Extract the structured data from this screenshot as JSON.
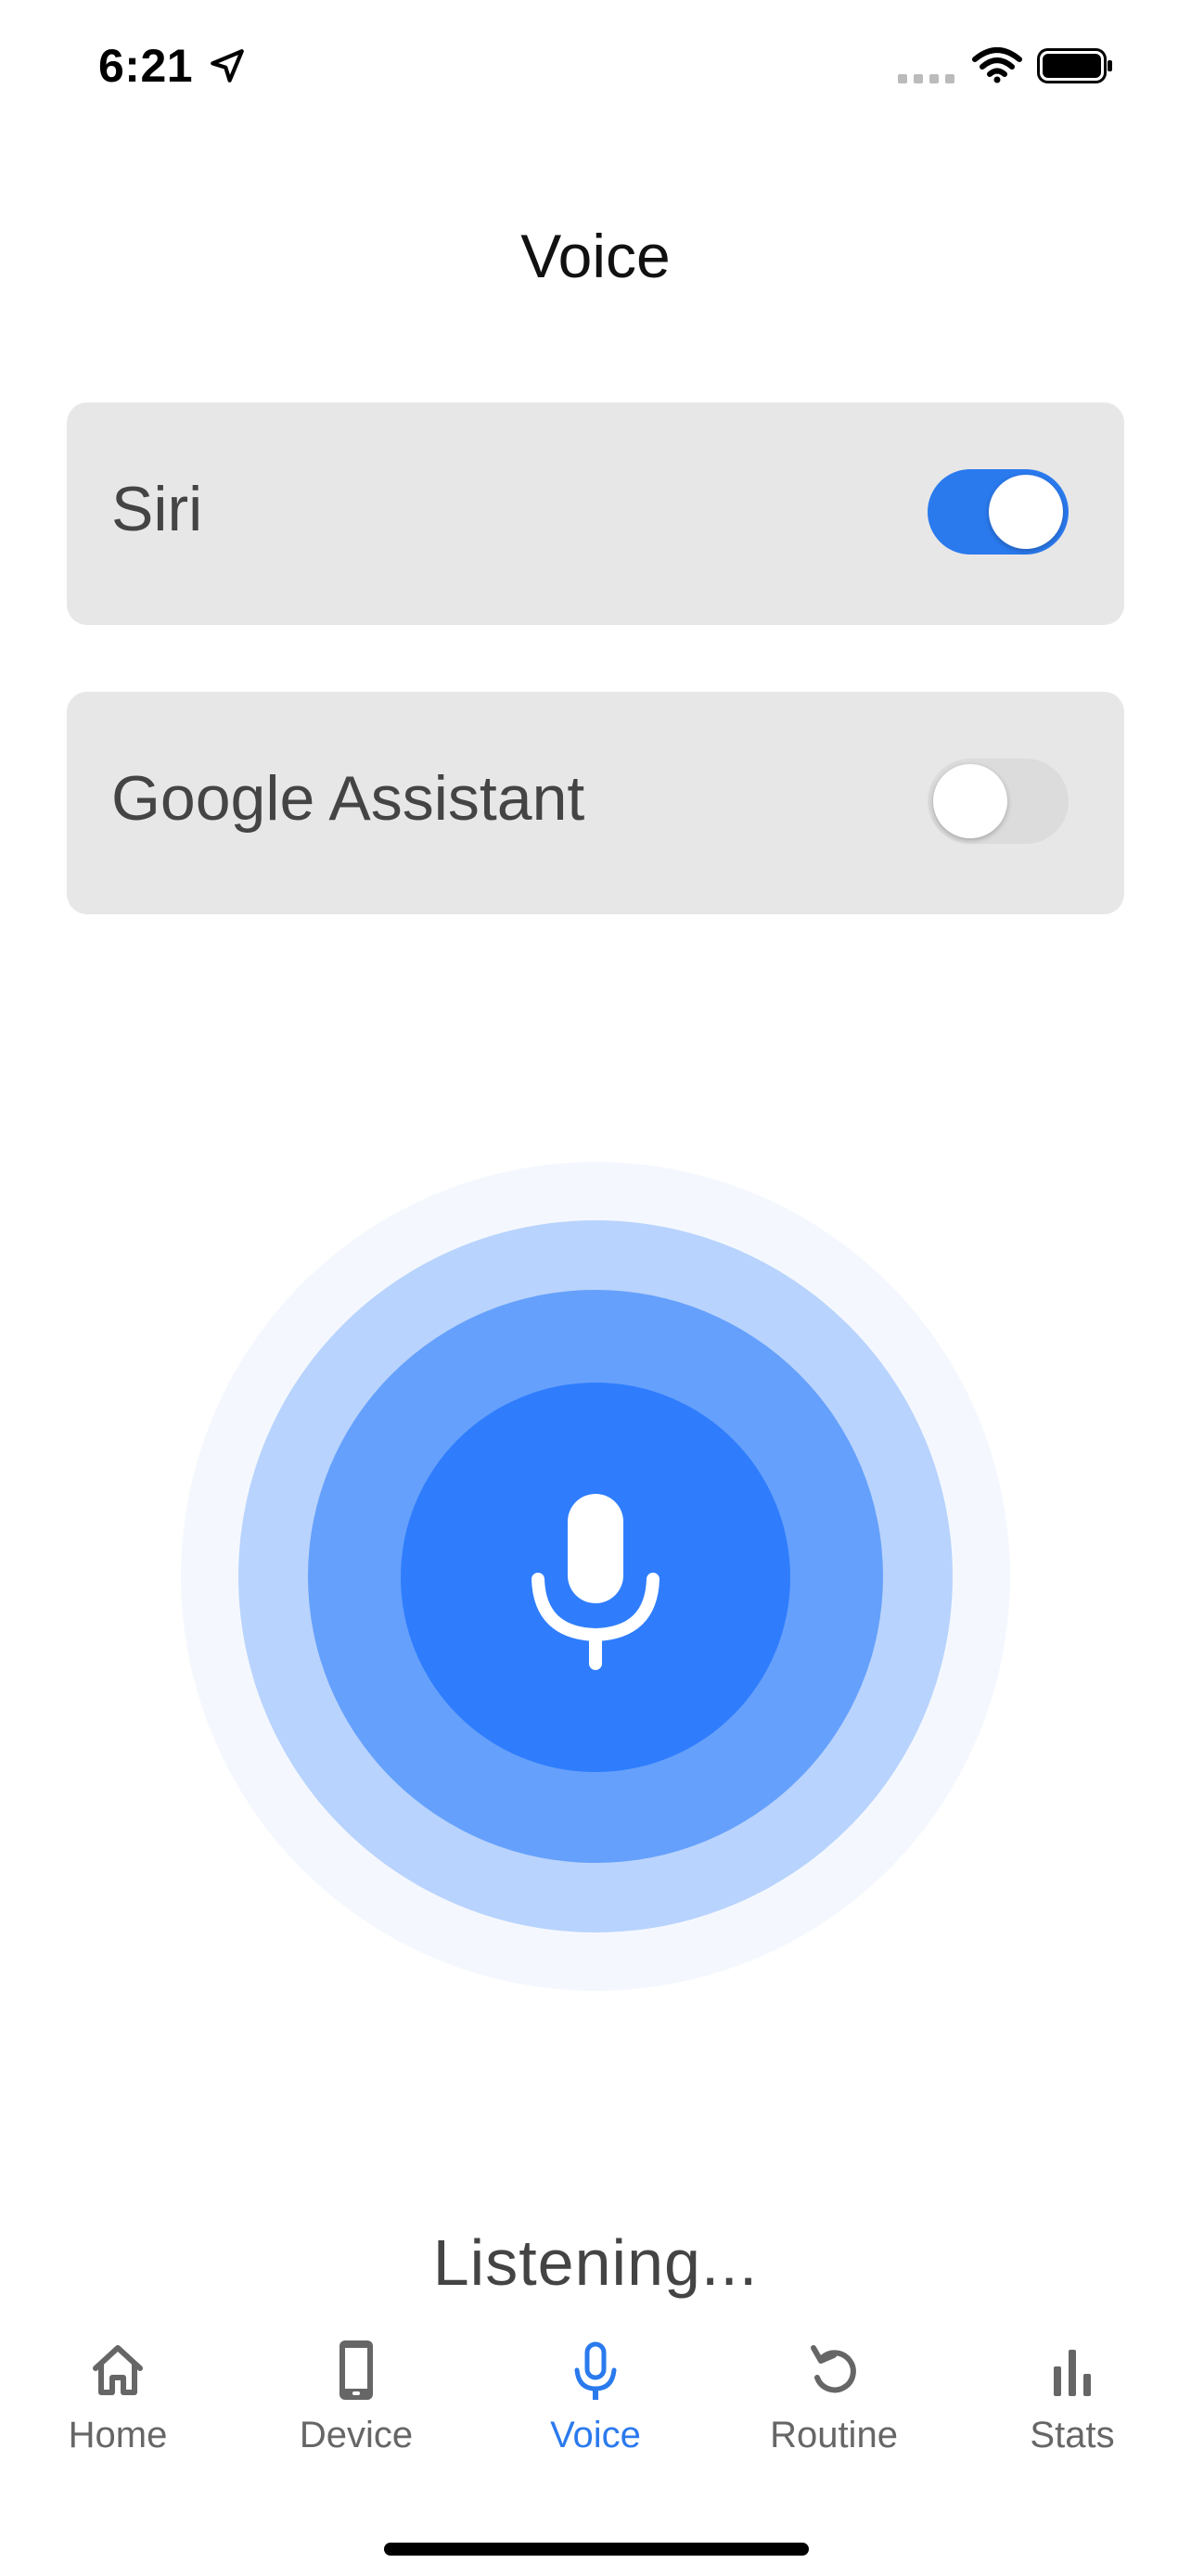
{
  "status_bar": {
    "time": "6:21",
    "icons": [
      "location-arrow-icon",
      "signal-icon",
      "wifi-icon",
      "battery-icon"
    ]
  },
  "header": {
    "title": "Voice"
  },
  "settings": [
    {
      "label": "Siri",
      "enabled": true
    },
    {
      "label": "Google Assistant",
      "enabled": false
    }
  ],
  "mic": {
    "icon": "microphone-icon",
    "status": "Listening..."
  },
  "tabs": [
    {
      "label": "Home",
      "icon": "home-icon",
      "active": false
    },
    {
      "label": "Device",
      "icon": "phone-device-icon",
      "active": false
    },
    {
      "label": "Voice",
      "icon": "microphone-icon",
      "active": true
    },
    {
      "label": "Routine",
      "icon": "refresh-icon",
      "active": false
    },
    {
      "label": "Stats",
      "icon": "bar-chart-icon",
      "active": false
    }
  ],
  "colors": {
    "accent": "#2a7aee",
    "mic_core": "#2f7dfd",
    "ring_mid": "#65a0fc",
    "ring_light": "#b8d3fd",
    "ring_outer": "#f4f8fe",
    "card_bg": "#e7e7e7",
    "inactive_tab": "#666666"
  }
}
